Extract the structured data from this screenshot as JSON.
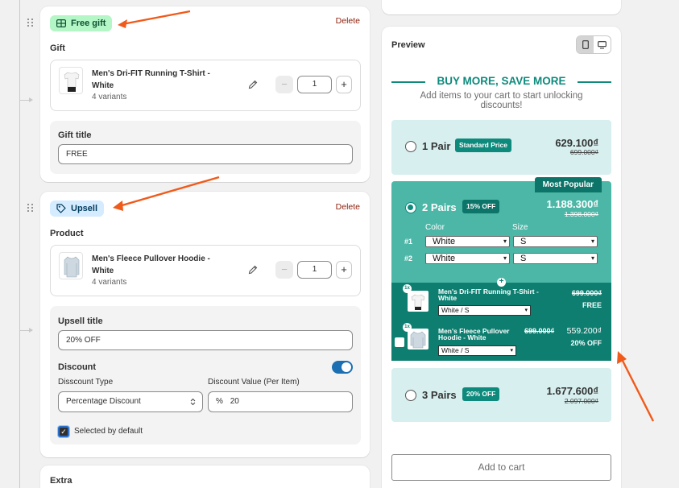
{
  "left": {
    "gift_card": {
      "badge": "Free gift",
      "delete_label": "Delete",
      "section_label": "Gift",
      "product": {
        "name": "Men's Dri-FIT Running T-Shirt - White",
        "variants": "4 variants",
        "quantity": "1"
      },
      "title_label": "Gift title",
      "title_value": "FREE"
    },
    "upsell_card": {
      "badge": "Upsell",
      "delete_label": "Delete",
      "section_label": "Product",
      "product": {
        "name": "Men's Fleece Pullover Hoodie - White",
        "variants": "4 variants",
        "quantity": "1"
      },
      "title_label": "Upsell title",
      "title_value": "20% OFF",
      "discount_label": "Discount",
      "discount_enabled": true,
      "discount_type_label": "Disscount Type",
      "discount_type_value": "Percentage Discount",
      "discount_value_label": "Discount Value (Per Item)",
      "discount_value_prefix": "%",
      "discount_value": "20",
      "selected_default_label": "Selected by default",
      "selected_default_checked": true
    },
    "extra_card": {
      "label": "Extra"
    }
  },
  "preview": {
    "title": "Preview",
    "headline": "BUY MORE, SAVE MORE",
    "subheadline": "Add items to your cart to start unlocking discounts!",
    "tiers": [
      {
        "name": "1 Pair",
        "pill": "Standard Price",
        "price": "629.100₫",
        "old_price": "699.000₫"
      },
      {
        "name": "2 Pairs",
        "pill": "15% OFF",
        "price": "1.188.300₫",
        "old_price": "1.398.000₫",
        "ribbon": "Most Popular",
        "color_label": "Color",
        "size_label": "Size",
        "rows": [
          {
            "num": "#1",
            "color": "White",
            "size": "S"
          },
          {
            "num": "#2",
            "color": "White",
            "size": "S"
          }
        ]
      },
      {
        "name": "3 Pairs",
        "pill": "20% OFF",
        "price": "1.677.600₫",
        "old_price": "2.097.000₫"
      }
    ],
    "addons": [
      {
        "qty": "1x",
        "name": "Men's Dri-FIT Running T-Shirt - White",
        "variant": "White / S",
        "old_price": "699.000₫",
        "label": "FREE"
      },
      {
        "qty": "1x",
        "name": "Men's Fleece Pullover Hoodie - White",
        "variant": "White / S",
        "old_price": "699.000₫",
        "price": "559.200₫",
        "label": "20% OFF"
      }
    ],
    "add_to_cart": "Add to cart"
  },
  "colors": {
    "accent": "#0e8a7d",
    "selected_tier": "#4cb7a7",
    "addon_panel": "#0d7e70",
    "tier_light": "#d7efef",
    "arrow": "#f05a1a"
  }
}
